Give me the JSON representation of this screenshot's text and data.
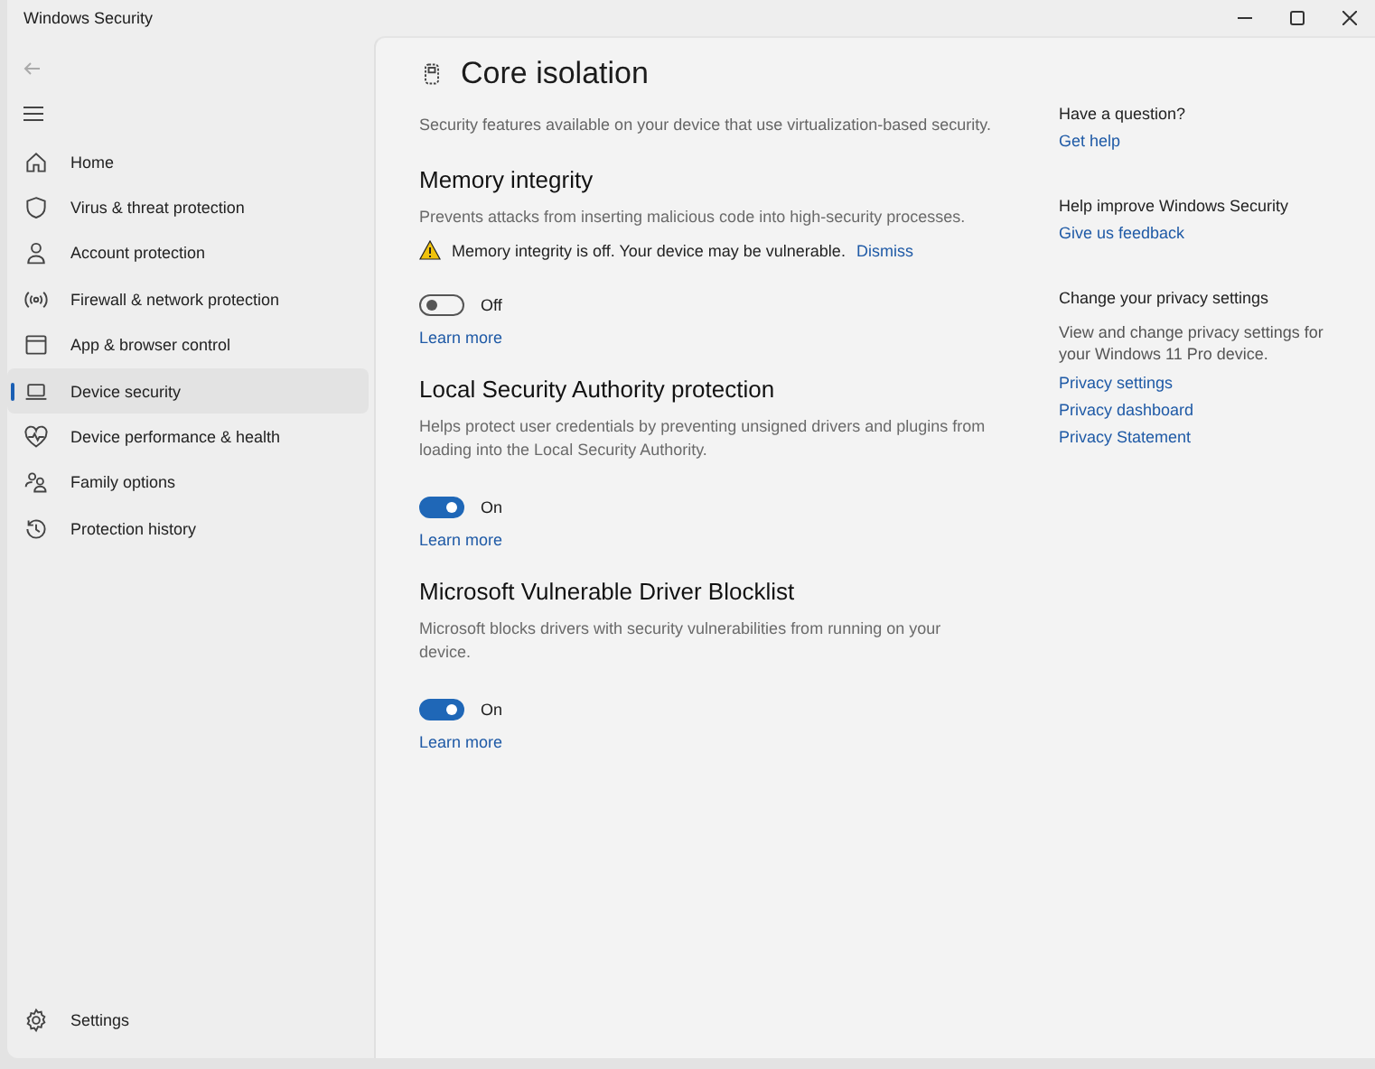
{
  "window": {
    "title": "Windows Security"
  },
  "sidebar": {
    "items": [
      {
        "label": "Home",
        "selected": false
      },
      {
        "label": "Virus & threat protection",
        "selected": false
      },
      {
        "label": "Account protection",
        "selected": false
      },
      {
        "label": "Firewall & network protection",
        "selected": false
      },
      {
        "label": "App & browser control",
        "selected": false
      },
      {
        "label": "Device security",
        "selected": true
      },
      {
        "label": "Device performance & health",
        "selected": false
      },
      {
        "label": "Family options",
        "selected": false
      },
      {
        "label": "Protection history",
        "selected": false
      }
    ],
    "settings": "Settings"
  },
  "page": {
    "title": "Core isolation",
    "description": "Security features available on your device that use virtualization-based security.",
    "sections": [
      {
        "title": "Memory integrity",
        "description": "Prevents attacks from inserting malicious code into high-security processes.",
        "warning": {
          "text": "Memory integrity is off. Your device may be vulnerable.",
          "action": "Dismiss"
        },
        "toggle": {
          "on": false,
          "label": "Off"
        },
        "link": "Learn more"
      },
      {
        "title": "Local Security Authority protection",
        "description": "Helps protect user credentials by preventing unsigned drivers and plugins from loading into the Local Security Authority.",
        "toggle": {
          "on": true,
          "label": "On"
        },
        "link": "Learn more"
      },
      {
        "title": "Microsoft Vulnerable Driver Blocklist",
        "description": "Microsoft blocks drivers with security vulnerabilities from running on your device.",
        "toggle": {
          "on": true,
          "label": "On"
        },
        "link": "Learn more"
      }
    ]
  },
  "aside": [
    {
      "title": "Have a question?",
      "links": [
        "Get help"
      ]
    },
    {
      "title": "Help improve Windows Security",
      "links": [
        "Give us feedback"
      ]
    },
    {
      "title": "Change your privacy settings",
      "text": "View and change privacy settings for your Windows 11 Pro device.",
      "links": [
        "Privacy settings",
        "Privacy dashboard",
        "Privacy Statement"
      ]
    }
  ]
}
